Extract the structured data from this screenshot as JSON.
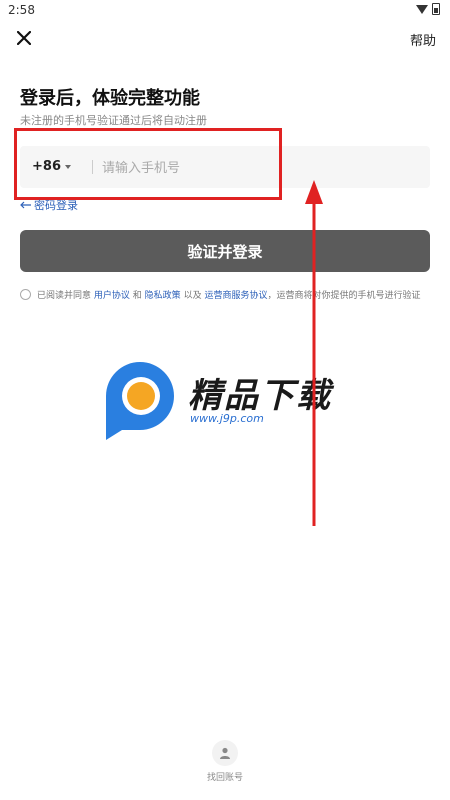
{
  "status_bar": {
    "time": "2:58"
  },
  "header": {
    "close_icon": "close-icon",
    "help_label": "帮助"
  },
  "main": {
    "title": "登录后，体验完整功能",
    "subtitle": "未注册的手机号验证通过后将自动注册",
    "country_code": "+86",
    "phone_placeholder": "请输入手机号",
    "password_login": "密码登录",
    "login_button": "验证并登录"
  },
  "agreement": {
    "prefix": "已阅读并同意",
    "user_agreement": "用户协议",
    "and": "和",
    "privacy_policy": "隐私政策",
    "also": "以及",
    "carrier_agreement": "运营商服务协议",
    "suffix": "，运营商将对你提供的手机号进行验证"
  },
  "watermark": {
    "brand": "精品下载",
    "url": "www.j9p.com"
  },
  "footer": {
    "recover_label": "找回账号"
  },
  "colors": {
    "accent_link": "#2b5fb8",
    "button_bg": "#5b5b5b",
    "annotation_red": "#e02222"
  }
}
